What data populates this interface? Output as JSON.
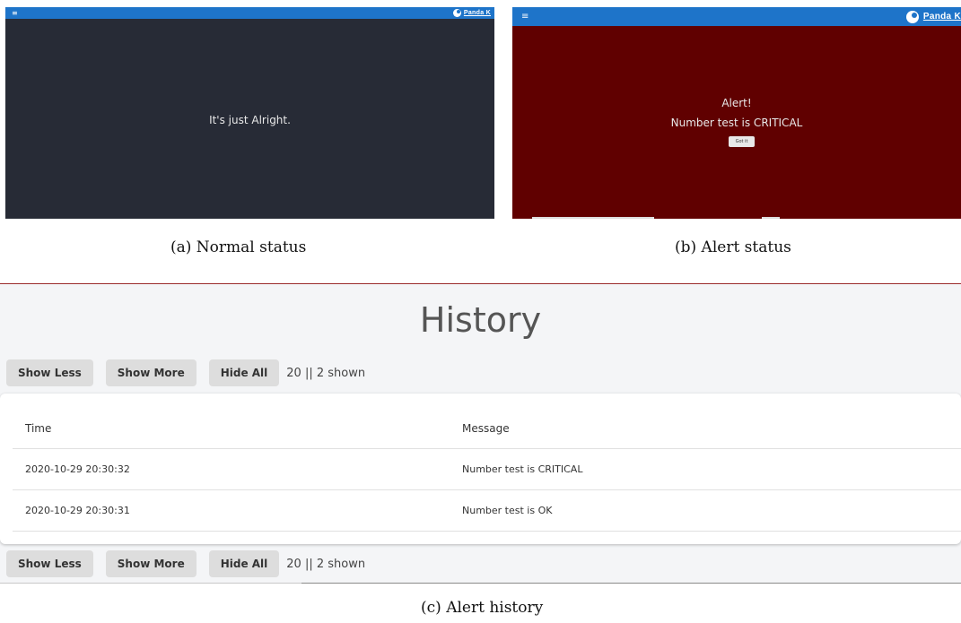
{
  "screenshots": {
    "normal": {
      "menu_icon": "≡",
      "brand": "Panda K",
      "status_text": "It's just Alright.",
      "background": "#272b36",
      "appbar_color": "#1e74c9"
    },
    "alert": {
      "menu_icon": "≡",
      "brand": "Panda K",
      "alert_title": "Alert!",
      "alert_message": "Number test is CRITICAL",
      "got_it_label": "Got it",
      "background": "#600000",
      "appbar_color": "#1e74c9"
    }
  },
  "captions": {
    "a": "(a) Normal status",
    "b": "(b) Alert status",
    "c": "(c) Alert history"
  },
  "history": {
    "title": "History",
    "buttons": {
      "show_less": "Show Less",
      "show_more": "Show More",
      "hide_all": "Hide All"
    },
    "count_text": "20 || 2 shown",
    "columns": [
      "Time",
      "Message"
    ],
    "rows": [
      {
        "time": "2020-10-29 20:30:32",
        "message": "Number test is CRITICAL"
      },
      {
        "time": "2020-10-29 20:30:31",
        "message": "Number test is OK"
      }
    ]
  }
}
